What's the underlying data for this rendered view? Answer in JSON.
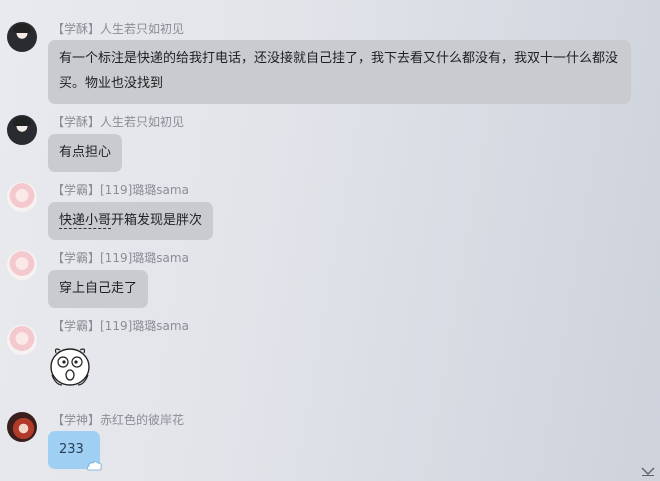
{
  "messages": [
    {
      "sender": "【学酥】人生若只如初见",
      "text_line1": "有一个标注是快递的给我打电话，还没接就自己挂了，我下去看又什么都没有，我双十一什么都没",
      "text_line2": "买。物业也没找到",
      "avatar": "dark-hair-girl-avatar"
    },
    {
      "sender": "【学酥】人生若只如初见",
      "text": "有点担心",
      "avatar": "dark-hair-girl-avatar"
    },
    {
      "sender": "【学霸】[119]璐璐sama",
      "text_underlined": "快递小哥",
      "text_rest": "开箱发现是胖次",
      "avatar": "pink-hair-girl-avatar"
    },
    {
      "sender": "【学霸】[119]璐璐sama",
      "text": "穿上自己走了",
      "avatar": "pink-hair-girl-avatar"
    },
    {
      "sender": "【学霸】[119]璐璐sama",
      "sticker": "surprised-face-sticker",
      "avatar": "pink-hair-girl-avatar"
    },
    {
      "sender": "【学神】赤红色的彼岸花",
      "text": "233",
      "avatar": "red-hair-avatar",
      "bubble_color": "#9fd0f4"
    }
  ],
  "scroll_icon": "chevron-down-icon",
  "colors": {
    "bubble_gray": "#c9cbd0",
    "bubble_blue": "#9fd0f4",
    "sender_text": "#8a8d93"
  }
}
